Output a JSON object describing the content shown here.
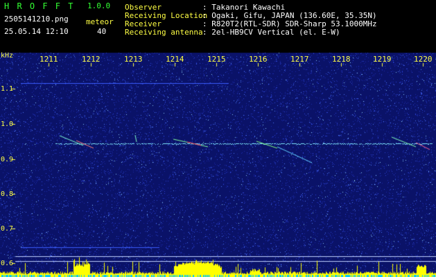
{
  "app": {
    "name": "H R O F F T",
    "version": "1.0.0"
  },
  "file": {
    "name": "2505141210.png",
    "datetime": "25.05.14 12:10"
  },
  "meteor": {
    "label": "meteor",
    "count": "40"
  },
  "info": [
    {
      "key": "Observer",
      "value": ": Takanori Kawachi"
    },
    {
      "key": "Receiving Location",
      "value": ": Ogaki, Gifu, JAPAN (136.60E, 35.35N)"
    },
    {
      "key": "Receiver",
      "value": ": R820T2(RTL-SDR) SDR-Sharp 53.1000MHz"
    },
    {
      "key": "Receiving antenna",
      "value": ": 2el-HB9CV Vertical (el. E-W)"
    }
  ],
  "axis": {
    "unit": "kHz",
    "y_ticks": [
      "1.1",
      "1.0",
      "0.9",
      "0.8",
      "0.7",
      "0.6"
    ],
    "x_ticks": [
      "1211",
      "1212",
      "1213",
      "1214",
      "1215",
      "1216",
      "1217",
      "1218",
      "1219",
      "1220"
    ]
  },
  "colors": {
    "background": "#000000",
    "spectrum": "#0c1470",
    "signal": "#80ffff",
    "label": "#ffff44",
    "app": "#33ff33"
  }
}
